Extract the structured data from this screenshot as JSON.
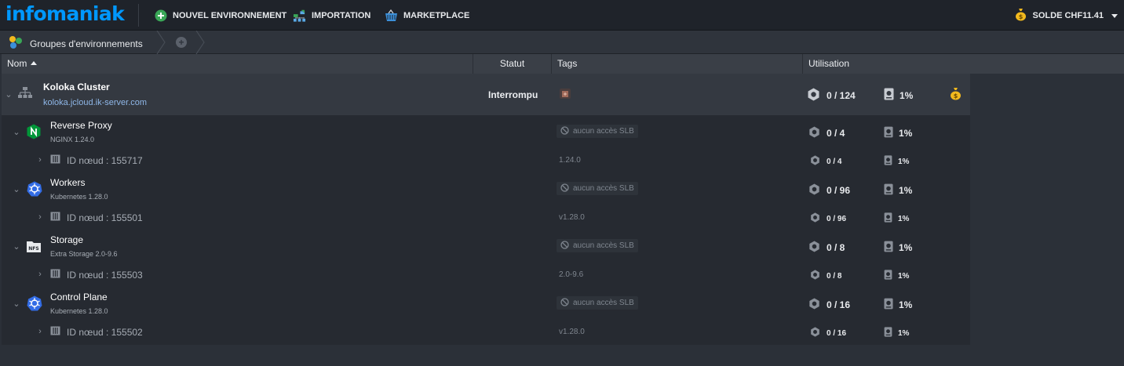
{
  "topbar": {
    "brand": "infomaniak",
    "new_env": "NOUVEL ENVIRONNEMENT",
    "import": "IMPORTATION",
    "marketplace": "MARKETPLACE",
    "balance": "SOLDE CHF11.41"
  },
  "breadcrumb": {
    "label": "Groupes d'environnements"
  },
  "table": {
    "headers": {
      "name": "Nom",
      "status": "Statut",
      "tags": "Tags",
      "usage": "Utilisation"
    },
    "environment": {
      "name": "Koloka Cluster",
      "domain": "koloka.jcloud.ik-server.com",
      "status": "Interrompu",
      "cloudlets": "0 / 124",
      "disk": "1%"
    },
    "nodes": [
      {
        "name": "Reverse Proxy",
        "subtitle": "NGINX 1.24.0",
        "tag": "aucun accès SLB",
        "cloudlets": "0 / 4",
        "disk": "1%",
        "node_label": "ID nœud : 155717",
        "node_version": "1.24.0",
        "node_cloudlets": "0 / 4",
        "node_disk": "1%"
      },
      {
        "name": "Workers",
        "subtitle": "Kubernetes 1.28.0",
        "tag": "aucun accès SLB",
        "cloudlets": "0 / 96",
        "disk": "1%",
        "node_label": "ID nœud : 155501",
        "node_version": "v1.28.0",
        "node_cloudlets": "0 / 96",
        "node_disk": "1%"
      },
      {
        "name": "Storage",
        "subtitle": "Extra Storage 2.0-9.6",
        "tag": "aucun accès SLB",
        "cloudlets": "0 / 8",
        "disk": "1%",
        "node_label": "ID nœud : 155503",
        "node_version": "2.0-9.6",
        "node_cloudlets": "0 / 8",
        "node_disk": "1%"
      },
      {
        "name": "Control Plane",
        "subtitle": "Kubernetes 1.28.0",
        "tag": "aucun accès SLB",
        "cloudlets": "0 / 16",
        "disk": "1%",
        "node_label": "ID nœud : 155502",
        "node_version": "v1.28.0",
        "node_cloudlets": "0 / 16",
        "node_disk": "1%"
      }
    ]
  },
  "colors": {
    "brand": "#0098ff",
    "background": "#2b3038",
    "topbar": "#1f232a",
    "nginx": "#009639",
    "kubernetes": "#326ce5",
    "coin": "#f2b91e"
  },
  "icons": [
    "plus-circle-icon",
    "import-icon",
    "marketplace-basket-icon",
    "coin-bag-icon",
    "env-group-icon",
    "cluster-topology-icon",
    "nginx-icon",
    "kubernetes-icon",
    "nfs-icon",
    "cloudlet-icon",
    "disk-icon",
    "node-server-icon",
    "ban-icon",
    "tag-icon"
  ]
}
